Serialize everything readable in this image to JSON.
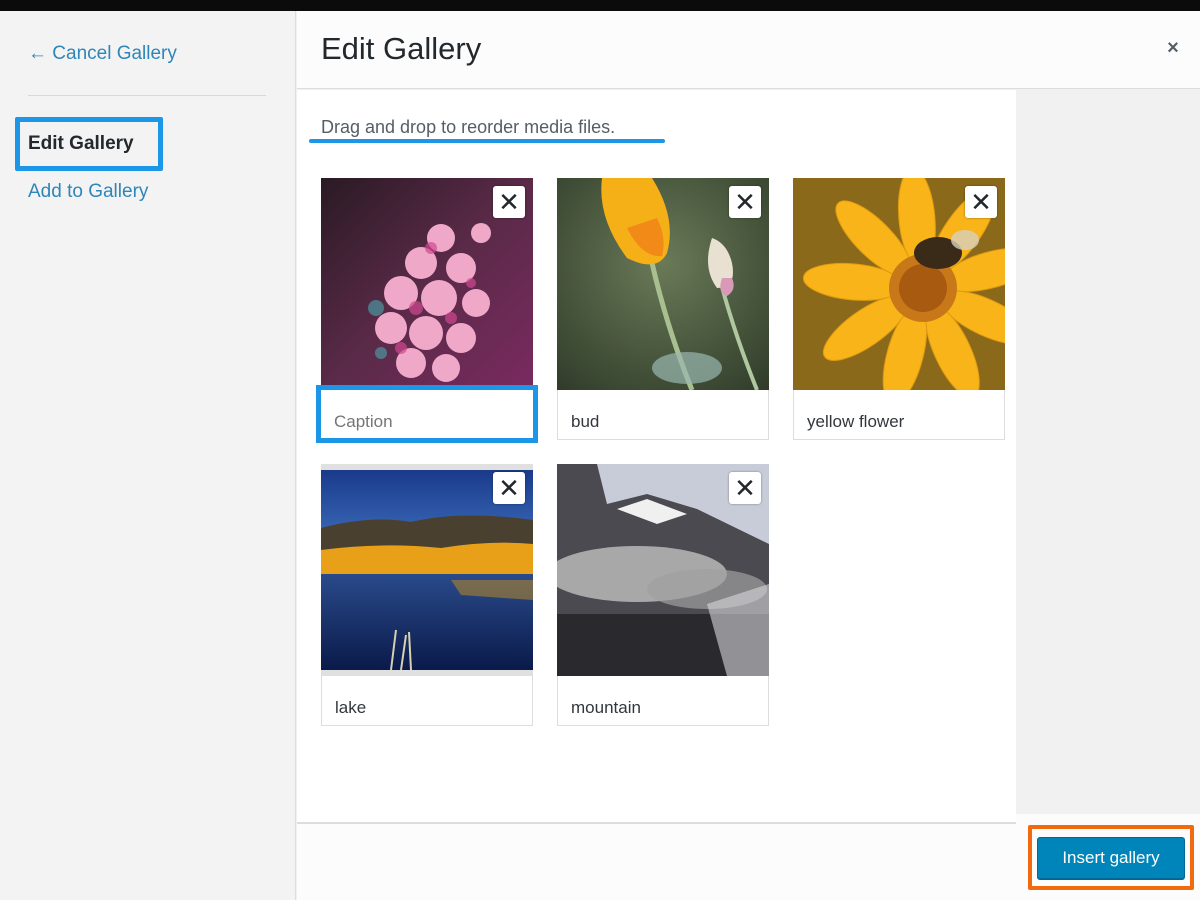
{
  "sidebar": {
    "cancel_label": "← Cancel Gallery",
    "active_item": "Edit Gallery",
    "add_label": "Add to Gallery"
  },
  "header": {
    "title": "Edit Gallery",
    "close_icon": "close-icon",
    "close_glyph": "×"
  },
  "content": {
    "instructions": "Drag and drop to reorder media files."
  },
  "gallery": {
    "remove_glyph": "✕",
    "items": [
      {
        "name": "pink-flowers",
        "caption": "",
        "caption_placeholder": "Caption",
        "active": true
      },
      {
        "name": "bud",
        "caption": "bud",
        "caption_placeholder": "Caption",
        "active": false
      },
      {
        "name": "yellow-flower",
        "caption": "yellow flower",
        "caption_placeholder": "Caption",
        "active": false
      },
      {
        "name": "lake",
        "caption": "lake",
        "caption_placeholder": "Caption",
        "active": false
      },
      {
        "name": "mountain",
        "caption": "mountain",
        "caption_placeholder": "Caption",
        "active": false
      }
    ]
  },
  "footer": {
    "insert_label": "Insert gallery"
  },
  "colors": {
    "highlight_blue": "#1c97e8",
    "highlight_orange": "#f26a10",
    "primary_button": "#0085ba",
    "link": "#2e86b8"
  }
}
